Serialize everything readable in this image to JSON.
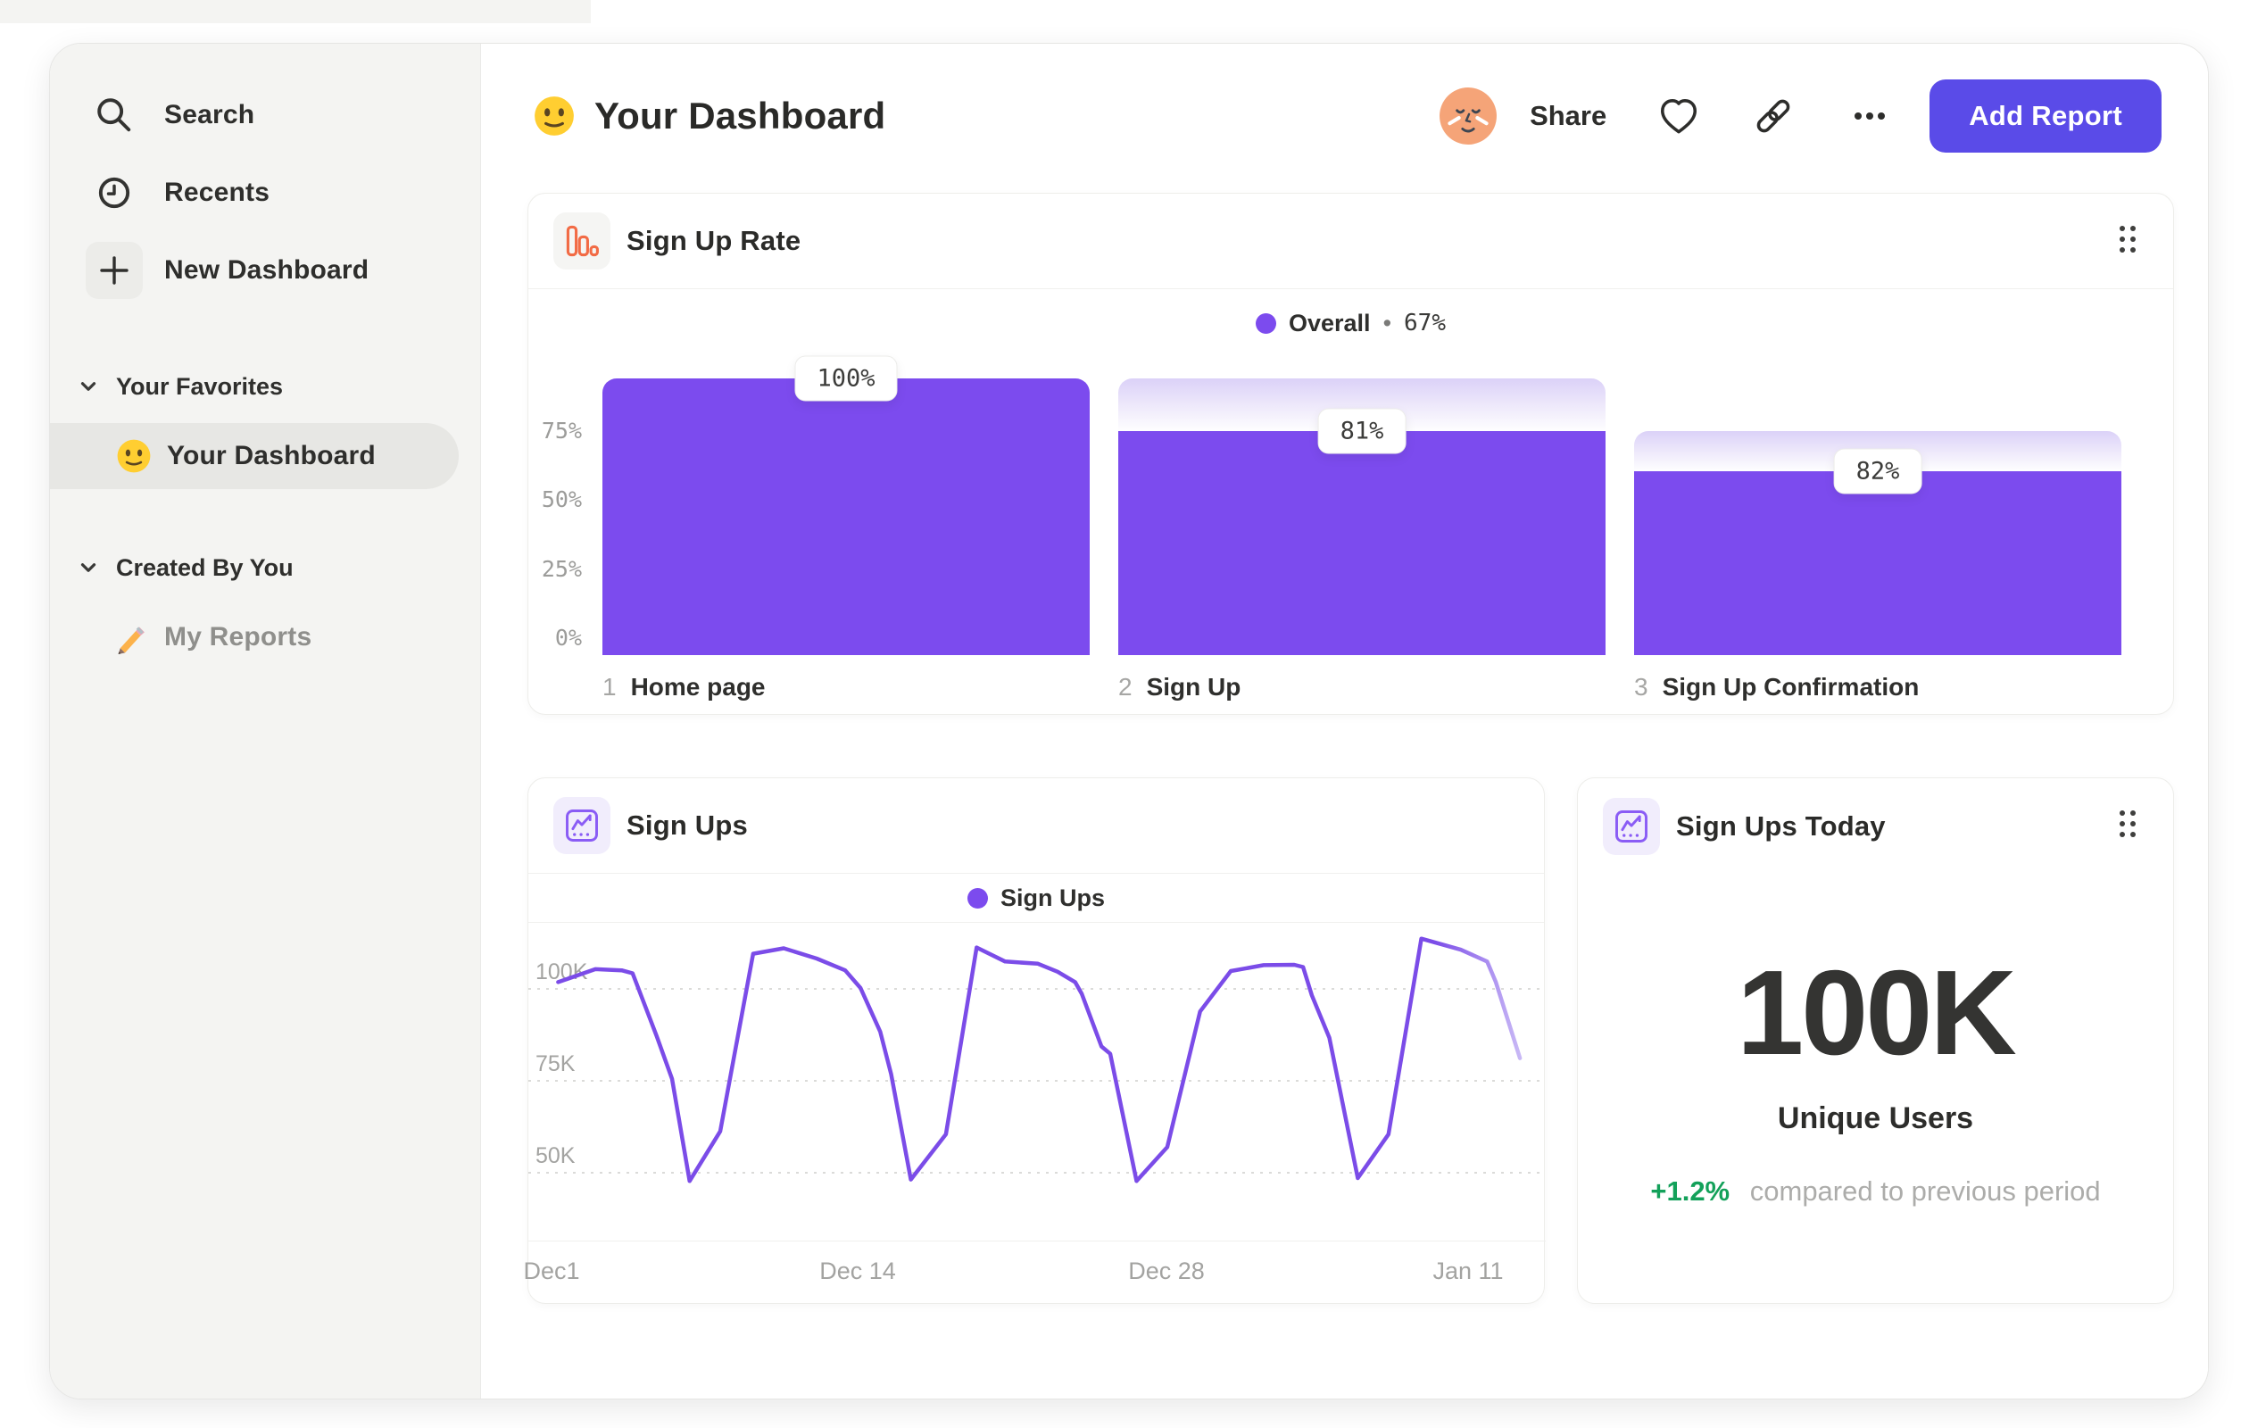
{
  "sidebar": {
    "items": [
      {
        "label": "Search",
        "icon": "search-icon"
      },
      {
        "label": "Recents",
        "icon": "clock-icon"
      },
      {
        "label": "New Dashboard",
        "icon": "plus-icon"
      }
    ],
    "sections": [
      {
        "title": "Your Favorites",
        "items": [
          {
            "label": "Your Dashboard",
            "emoji": "slightly-smiling-face",
            "selected": true
          }
        ]
      },
      {
        "title": "Created By You",
        "items": [
          {
            "label": "My Reports",
            "emoji": "pencil",
            "selected": false
          }
        ]
      }
    ]
  },
  "header": {
    "title": "Your Dashboard",
    "title_emoji": "slightly-smiling-face",
    "share_label": "Share",
    "add_report_label": "Add Report",
    "accent_color": "#5A4BE8"
  },
  "cards": {
    "signup_rate": {
      "title": "Sign Up Rate",
      "legend_name": "Overall",
      "legend_separator": "•",
      "legend_value": "67%"
    },
    "signups": {
      "title": "Sign Ups",
      "legend_name": "Sign Ups"
    },
    "signups_today": {
      "title": "Sign Ups Today",
      "value": "100K",
      "subtitle": "Unique Users",
      "delta": "+1.2%",
      "delta_note": "compared to previous period",
      "delta_color": "#13A15A"
    }
  },
  "chart_data": [
    {
      "type": "bar",
      "subtype": "funnel",
      "title": "Sign Up Rate",
      "legend": {
        "series": "Overall",
        "value": "67%",
        "position": "top-center",
        "color": "#7C4BEE"
      },
      "categories": [
        "Home page",
        "Sign Up",
        "Sign Up Confirmation"
      ],
      "step_numbers": [
        "1",
        "2",
        "3"
      ],
      "bars": [
        {
          "category": "Home page",
          "total_pct": 100,
          "solid_pct": 100,
          "label": "100%"
        },
        {
          "category": "Sign Up",
          "total_pct": 100,
          "solid_pct": 81,
          "label": "81%"
        },
        {
          "category": "Sign Up Confirmation",
          "total_pct": 81,
          "solid_pct": 66.4,
          "label": "82%"
        }
      ],
      "yticks": [
        {
          "value": 75,
          "label": "75%"
        },
        {
          "value": 50,
          "label": "50%"
        },
        {
          "value": 25,
          "label": "25%"
        },
        {
          "value": 0,
          "label": "0%"
        }
      ],
      "ylim": [
        0,
        100
      ],
      "overall_conversion": "67%",
      "bar_color": "#7C4BEE",
      "grid": false
    },
    {
      "type": "line",
      "title": "Sign Ups",
      "legend": {
        "series": "Sign Ups",
        "position": "top-center",
        "color": "#7C4BEE"
      },
      "x_tick_labels": [
        "Dec1",
        "Dec 14",
        "Dec 28",
        "Jan 11"
      ],
      "yticks": [
        {
          "value": 100,
          "label": "100K"
        },
        {
          "value": 75,
          "label": "75K"
        },
        {
          "value": 50,
          "label": "50K"
        }
      ],
      "unit": "thousands of sign ups",
      "x_unit": "days since Dec 1",
      "line_color": "#7B4CE8",
      "grid": "dashed-horizontal",
      "points": [
        [
          0.3,
          97
        ],
        [
          2,
          100.5
        ],
        [
          3.2,
          100.2
        ],
        [
          3.7,
          99.4
        ],
        [
          4.8,
          82.3
        ],
        [
          5.5,
          70.7
        ],
        [
          6.3,
          42.9
        ],
        [
          7.7,
          56.4
        ],
        [
          9.2,
          104.7
        ],
        [
          10.6,
          106.2
        ],
        [
          12.1,
          103.4
        ],
        [
          13.4,
          100.2
        ],
        [
          14.1,
          95.4
        ],
        [
          15,
          83.5
        ],
        [
          15.5,
          72
        ],
        [
          16.4,
          43.3
        ],
        [
          18,
          55.6
        ],
        [
          19.4,
          106.4
        ],
        [
          20.7,
          102.6
        ],
        [
          22.2,
          102
        ],
        [
          23.1,
          99.8
        ],
        [
          23.9,
          97
        ],
        [
          24.2,
          93.8
        ],
        [
          25.1,
          79.5
        ],
        [
          25.5,
          77.5
        ],
        [
          26.7,
          42.9
        ],
        [
          28.1,
          52.1
        ],
        [
          29.6,
          89
        ],
        [
          31,
          100
        ],
        [
          32.5,
          101.6
        ],
        [
          33.9,
          101.7
        ],
        [
          34.3,
          101.1
        ],
        [
          34.7,
          93.4
        ],
        [
          35.5,
          81.9
        ],
        [
          36.8,
          43.7
        ],
        [
          38.2,
          55.6
        ],
        [
          39.7,
          108.8
        ],
        [
          41.5,
          105.8
        ],
        [
          42.7,
          102.6
        ],
        [
          43.1,
          97
        ],
        [
          44.2,
          76.3
        ]
      ]
    }
  ]
}
